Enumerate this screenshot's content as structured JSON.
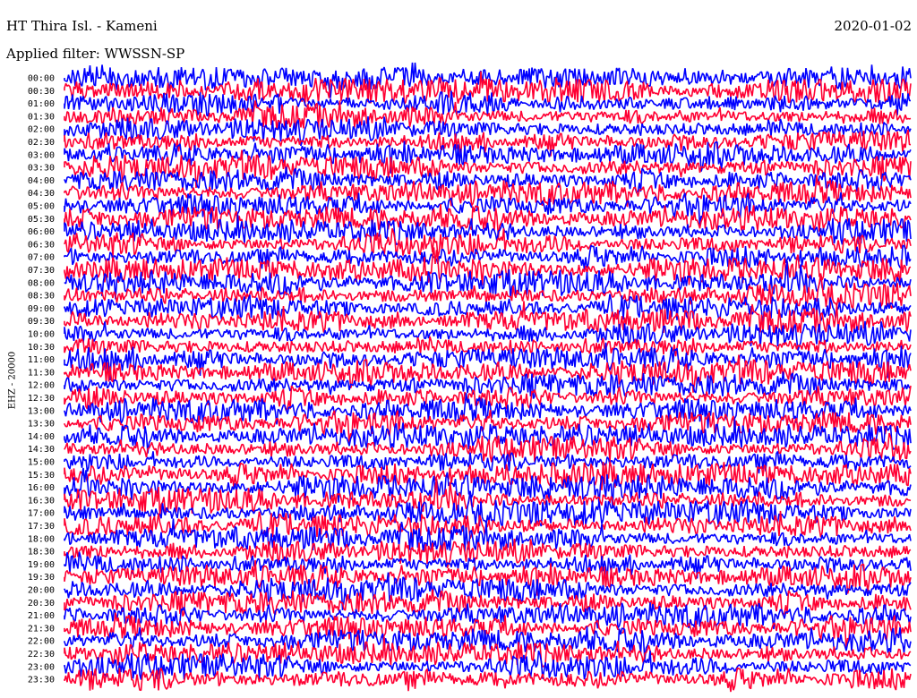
{
  "header": {
    "station": "HT Thira Isl. - Kameni",
    "date": "2020-01-02",
    "filter": "Applied filter: WWSSN-SP",
    "channel": "EHZ - 20000"
  },
  "chart_data": {
    "type": "line",
    "title": "HT Thira Isl. - Kameni",
    "ylabel": "EHZ - 20000",
    "y_tick_labels": [
      "00:00",
      "00:30",
      "01:00",
      "01:30",
      "02:00",
      "02:30",
      "03:00",
      "03:30",
      "04:00",
      "04:30",
      "05:00",
      "05:30",
      "06:00",
      "06:30",
      "07:00",
      "07:30",
      "08:00",
      "08:30",
      "09:00",
      "09:30",
      "10:00",
      "10:30",
      "11:00",
      "11:30",
      "12:00",
      "12:30",
      "13:00",
      "13:30",
      "14:00",
      "14:30",
      "15:00",
      "15:30",
      "16:00",
      "16:30",
      "17:00",
      "17:30",
      "18:00",
      "18:30",
      "19:00",
      "19:30",
      "20:00",
      "20:30",
      "21:00",
      "21:30",
      "22:00",
      "22:30",
      "23:00",
      "23:30"
    ],
    "trace_colors": [
      "#0000ff",
      "#ff0033"
    ],
    "grid": false,
    "note_colors": {
      "background": "#ffffff",
      "text": "#000000"
    }
  }
}
